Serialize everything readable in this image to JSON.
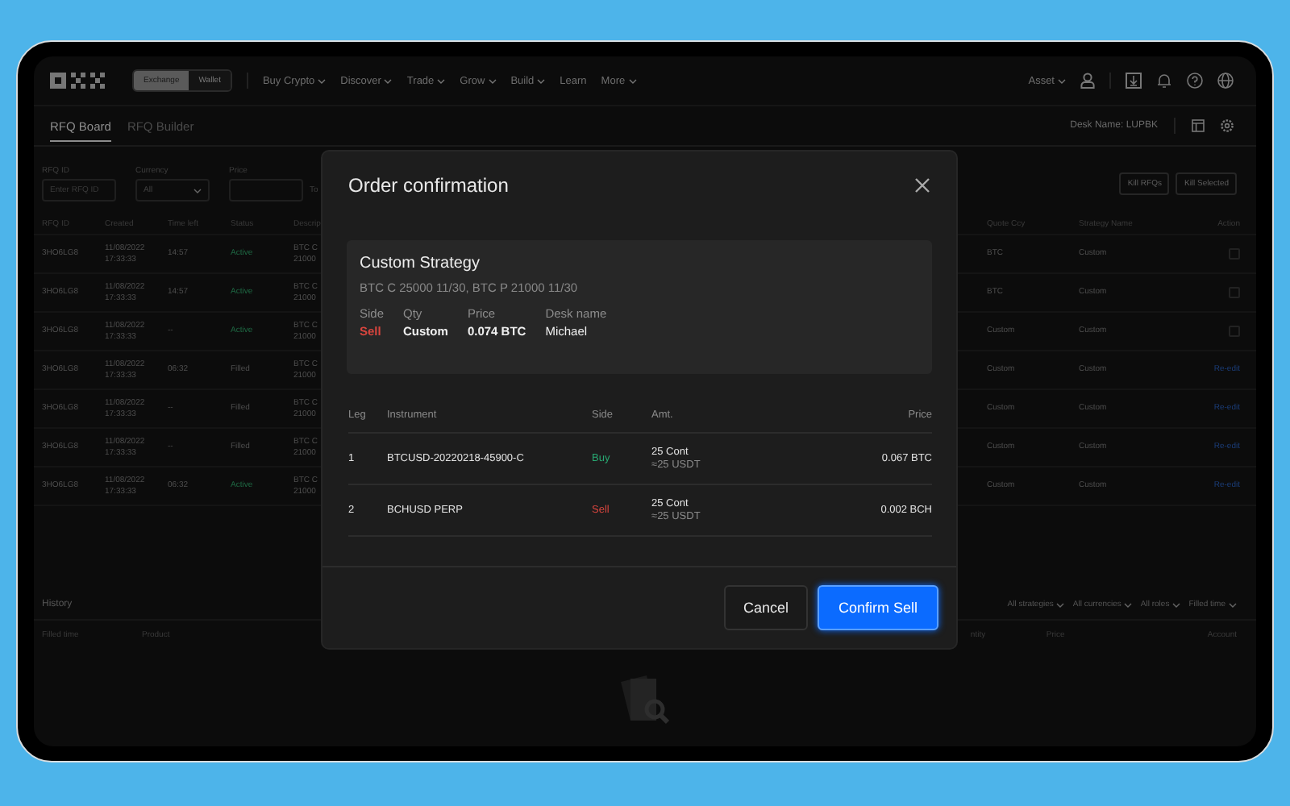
{
  "nav": {
    "exchange_toggle": [
      {
        "label": "Exchange",
        "selected": true
      },
      {
        "label": "Wallet",
        "selected": false
      }
    ],
    "menu": [
      {
        "label": "Buy Crypto",
        "has_menu": true
      },
      {
        "label": "Discover",
        "has_menu": true
      },
      {
        "label": "Trade",
        "has_menu": true
      },
      {
        "label": "Grow",
        "has_menu": true
      },
      {
        "label": "Build",
        "has_menu": true
      },
      {
        "label": "Learn",
        "has_menu": false
      },
      {
        "label": "More",
        "has_menu": true
      }
    ],
    "asset": "Asset"
  },
  "tabs": [
    {
      "label": "RFQ Board",
      "selected": true
    },
    {
      "label": "RFQ Builder",
      "selected": false
    }
  ],
  "desk_name": "Desk Name: LUPBK",
  "filters": {
    "rfq_id_label": "RFQ ID",
    "rfq_id_placeholder": "Enter RFQ ID",
    "currency_label": "Currency",
    "currency_value": "All",
    "price_label": "Price",
    "to_label": "To"
  },
  "actions": [
    "Kill RFQs",
    "Kill Selected"
  ],
  "table": {
    "columns_left": [
      "RFQ ID",
      "Created",
      "Time left",
      "Status",
      "Descrip"
    ],
    "columns_right": [
      "Quote Ccy",
      "Strategy Name",
      "Action"
    ],
    "rows": [
      {
        "rfq_id": "3HO6LG8",
        "created": [
          "11/08/2022",
          "17:33:33"
        ],
        "time_left": "14:57",
        "status": "Active",
        "status_active": true,
        "description": [
          "BTC C",
          "21000"
        ],
        "quote_ccy": "BTC",
        "strategy": "Custom",
        "action": {
          "kind": "checkbox",
          "checked": false
        }
      },
      {
        "rfq_id": "3HO6LG8",
        "created": [
          "11/08/2022",
          "17:33:33"
        ],
        "time_left": "14:57",
        "status": "Active",
        "status_active": true,
        "description": [
          "BTC C",
          "21000"
        ],
        "quote_ccy": "BTC",
        "strategy": "Custom",
        "action": {
          "kind": "checkbox",
          "checked": false
        }
      },
      {
        "rfq_id": "3HO6LG8",
        "created": [
          "11/08/2022",
          "17:33:33"
        ],
        "time_left": "--",
        "status": "Active",
        "status_active": true,
        "description": [
          "BTC C",
          "21000"
        ],
        "quote_ccy": "Custom",
        "strategy": "Custom",
        "action": {
          "kind": "checkbox",
          "checked": false
        }
      },
      {
        "rfq_id": "3HO6LG8",
        "created": [
          "11/08/2022",
          "17:33:33"
        ],
        "time_left": "06:32",
        "status": "Filled",
        "status_active": false,
        "description": [
          "BTC C",
          "21000"
        ],
        "quote_ccy": "Custom",
        "strategy": "Custom",
        "action": {
          "kind": "link",
          "label": "Re-edit"
        }
      },
      {
        "rfq_id": "3HO6LG8",
        "created": [
          "11/08/2022",
          "17:33:33"
        ],
        "time_left": "--",
        "status": "Filled",
        "status_active": false,
        "description": [
          "BTC C",
          "21000"
        ],
        "quote_ccy": "Custom",
        "strategy": "Custom",
        "action": {
          "kind": "link",
          "label": "Re-edit"
        }
      },
      {
        "rfq_id": "3HO6LG8",
        "created": [
          "11/08/2022",
          "17:33:33"
        ],
        "time_left": "--",
        "status": "Filled",
        "status_active": false,
        "description": [
          "BTC C",
          "21000"
        ],
        "quote_ccy": "Custom",
        "strategy": "Custom",
        "action": {
          "kind": "link",
          "label": "Re-edit"
        }
      },
      {
        "rfq_id": "3HO6LG8",
        "created": [
          "11/08/2022",
          "17:33:33"
        ],
        "time_left": "06:32",
        "status": "Active",
        "status_active": true,
        "description": [
          "BTC C",
          "21000"
        ],
        "quote_ccy": "Custom",
        "strategy": "Custom",
        "action": {
          "kind": "link",
          "label": "Re-edit"
        }
      }
    ]
  },
  "history": {
    "title": "History",
    "filters": [
      "All strategies",
      "All currencies",
      "All roles",
      "Filled time"
    ],
    "columns_left": [
      "Filled time",
      "Product"
    ],
    "columns_right": [
      "ntity",
      "Price",
      "Account"
    ]
  },
  "modal": {
    "title": "Order confirmation",
    "summary": {
      "title": "Custom Strategy",
      "subtitle": "BTC C 25000 11/30, BTC P 21000 11/30",
      "fields": [
        {
          "label": "Side",
          "value": "Sell",
          "alert": true
        },
        {
          "label": "Qty",
          "value": "Custom",
          "alert": false
        },
        {
          "label": "Price",
          "value": "0.074 BTC",
          "alert": false
        },
        {
          "label": "Desk name",
          "value": "Michael",
          "alert": false
        }
      ]
    },
    "legs": {
      "columns": [
        "Leg",
        "Instrument",
        "Side",
        "Amt.",
        "Price"
      ],
      "rows": [
        {
          "leg": "1",
          "instrument": "BTCUSD-20220218-45900-C",
          "side": "Buy",
          "is_buy": true,
          "amount": "25 Cont",
          "amount_usdt": "≈25 USDT",
          "price": "0.067 BTC"
        },
        {
          "leg": "2",
          "instrument": "BCHUSD PERP",
          "side": "Sell",
          "is_buy": false,
          "amount": "25 Cont",
          "amount_usdt": "≈25 USDT",
          "price": "0.002 BCH"
        }
      ]
    },
    "buttons": [
      {
        "label": "Cancel",
        "kind": "secondary"
      },
      {
        "label": "Confirm Sell",
        "kind": "primary"
      }
    ]
  }
}
